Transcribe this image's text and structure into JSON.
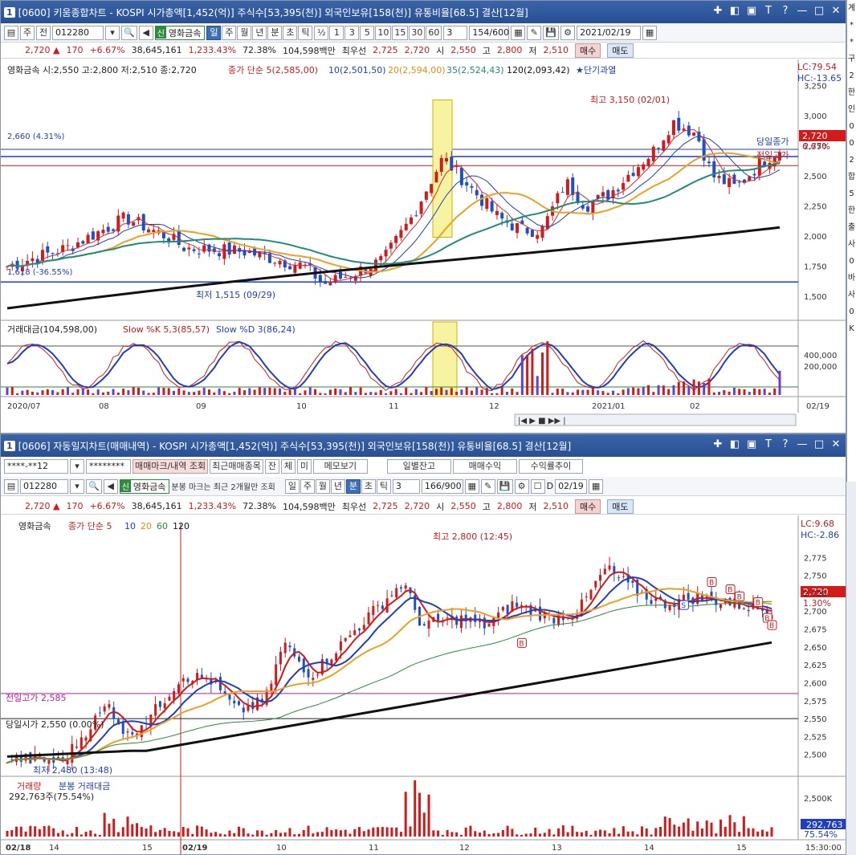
{
  "window1": {
    "title": "[0600] 키움종합차트 - KOSPI 시가총액[1,452(억)] 주식수[53,395(천)] 외국인보유[158(천)] 유통비율[68.5] 결산[12월]",
    "window_num": "1",
    "toolbar": {
      "period_week": "주",
      "prev": "전",
      "code": "012280",
      "name_tag": "신",
      "stock_name": "영화금속",
      "periods": [
        "일",
        "주",
        "월",
        "년",
        "분",
        "초",
        "틱"
      ],
      "active_period": "일",
      "fractions": [
        "½",
        "1",
        "3",
        "5",
        "10",
        "15",
        "30",
        "60"
      ],
      "count_sel": "3",
      "bar_count": "154",
      "bar_total": "/600",
      "date": "2021/02/19"
    },
    "price": {
      "current": "2,720",
      "arrow": "▲",
      "change": "170",
      "rate": "+6.67%",
      "volume": "38,645,161",
      "vol_rate": "1,233.43%",
      "turnover": "72.38%",
      "amount": "104,598백만",
      "ask_label": "최우선",
      "ask": "2,725",
      "bid": "2,720",
      "open_label": "시",
      "open": "2,550",
      "high_label": "고",
      "high": "2,800",
      "low_label": "저",
      "low": "2,510",
      "buy": "매수",
      "sell": "매도"
    },
    "chart_legend": {
      "ohlc": "영화금속 시:2,550 고:2,800 저:2,510 종:2,720",
      "ma_label": "종가 단순 5(2,585,00)",
      "ma10": "10(2,501,50)",
      "ma20": "20(2,594,00)",
      "ma35": "35(2,524,43)",
      "ma120": "120(2,093,42)",
      "star": "★단기과열"
    },
    "annotations": {
      "high": "최고 3,150 (02/01)",
      "low": "최저 1,515 (09/29)",
      "hline1": "2,660 (4.31%)",
      "hline2": "1,618 (-36.55%)",
      "today_close": "당일종가",
      "prev_high": "전일고가",
      "lc": "LC:79.54",
      "hc": "HC:-13.65",
      "price_tag": "2,720",
      "price_pct": "6.67%"
    },
    "y_axis": [
      "3,250",
      "3,000",
      "2,750",
      "2,500",
      "2,250",
      "2,000",
      "1,750",
      "1,500"
    ],
    "sub_legend": {
      "amount": "거래대금(104,598,00)",
      "slowk": "Slow %K 5,3(85,57)",
      "slowd": "Slow %D 3(86,24)"
    },
    "sub_axis": [
      "400,000",
      "200,000"
    ],
    "x_axis": [
      "2020/07",
      "08",
      "09",
      "10",
      "11",
      "12",
      "2021/01",
      "02",
      "02/19"
    ],
    "colors": {
      "up": "#d21a1a",
      "down": "#1f4fc8",
      "ma5": "#e0262c",
      "ma10": "#1f3fbf",
      "ma20": "#f0a020",
      "ma35": "#1f8c7a",
      "ma120": "#111111"
    }
  },
  "window2": {
    "title": "[0606] 자동일지차트(매매내역) - KOSPI 시가총액[1,452(억)] 주식수[53,395(천)] 외국인보유[158(천)] 유통비율[68.5] 결산[12월]",
    "window_num": "1",
    "account": "****-**12",
    "password": "********",
    "tabs": [
      "매매마크/내역 조회",
      "최근매매종목",
      "잔",
      "체",
      "미",
      "메모보기"
    ],
    "right_tabs": [
      "일별잔고",
      "매매수익",
      "수익률추이"
    ],
    "toolbar": {
      "code": "012280",
      "name_tag": "신",
      "stock_name": "영화금속",
      "note": "분봉 마크는 최근 2개월만 조회",
      "periods": [
        "일",
        "주",
        "월",
        "년",
        "분",
        "초",
        "틱"
      ],
      "active_period": "분",
      "day_count": "3",
      "min_count": "3",
      "bar_count": "166",
      "bar_total": "/900",
      "d_label": "D",
      "date": "02/19"
    },
    "legend": {
      "name": "영화금속",
      "ma": "종가 단순 5",
      "ma10": "10",
      "ma20": "20",
      "ma60": "60",
      "ma120": "120"
    },
    "annotations": {
      "high": "최고 2,800 (12:45)",
      "low": "최저 2,480 (13:48)",
      "prev_high": "전일고가 2,585",
      "open_line": "당일시가 2,550 (0.00%)",
      "lc": "LC:9.68",
      "hc": "HC:-2.86",
      "price_tag": "2,720",
      "price_pct": "1.30%"
    },
    "y_axis": [
      "2,775",
      "2,750",
      "2,725",
      "2,700",
      "2,675",
      "2,650",
      "2,625",
      "2,600",
      "2,575",
      "2,550",
      "2,525",
      "2,500"
    ],
    "sub_legend": {
      "volume": "거래량",
      "amount": "분봉 거래대금",
      "value": "292,763주(75.54%)"
    },
    "sub_axis": [
      "2,500K"
    ],
    "sub_tag": "292,763",
    "sub_pct": "75.54%",
    "x_axis": [
      "02/18",
      "14",
      "15",
      "02/19",
      "10",
      "11",
      "12",
      "13",
      "14",
      "15",
      "15:30:00"
    ]
  },
  "side_chars": [
    "계",
    "*",
    "*",
    "구",
    "2",
    "한",
    "인",
    "0",
    "0",
    "2",
    "합",
    "5",
    "한",
    "출",
    "사",
    "0",
    "바",
    "사",
    "0",
    "K"
  ]
}
